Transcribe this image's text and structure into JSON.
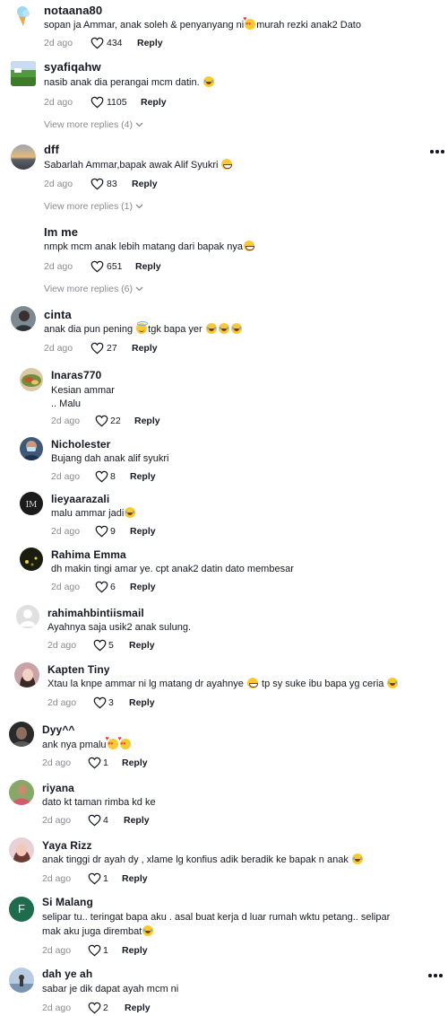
{
  "comments": [
    {
      "username": "notaana80",
      "text_parts": [
        "sopan ja Ammar, anak soleh & penyanyang ni",
        "murah rezki anak2 Dato"
      ],
      "emojis": [
        "smiling-face-with-hearts"
      ],
      "time": "2d ago",
      "likes": "434",
      "reply": "Reply",
      "avatar": "ice-cream-avatar"
    },
    {
      "username": "syafiqahw",
      "text_parts": [
        "nasib anak dia perangai mcm datin. "
      ],
      "emojis": [
        "face-with-tears-of-joy"
      ],
      "time": "2d ago",
      "likes": "1105",
      "reply": "Reply",
      "view_more": "View more replies (4)",
      "avatar": "green-landscape-avatar"
    },
    {
      "username": "dff",
      "text_parts": [
        "Sabarlah Ammar,bapak awak Alif Syukri "
      ],
      "emojis": [
        "grinning-sweat-face"
      ],
      "time": "2d ago",
      "likes": "83",
      "reply": "Reply",
      "view_more": "View more replies (1)",
      "avatar": "sunset-avatar"
    },
    {
      "username": "Im me",
      "text_parts": [
        "nmpk mcm anak lebih matang dari bapak nya"
      ],
      "emojis": [
        "grinning-sweat-face"
      ],
      "time": "2d ago",
      "likes": "651",
      "reply": "Reply",
      "view_more": "View more replies (6)"
    },
    {
      "username": "cinta",
      "text_parts": [
        "anak dia pun pening ",
        "tgk bapa yer "
      ],
      "emojis": [
        "smiling-face-with-halo",
        "face-with-tears-of-joy x3"
      ],
      "time": "2d ago",
      "likes": "27",
      "reply": "Reply",
      "avatar": "person-avatar"
    },
    {
      "username": "Inaras770",
      "text_lines": [
        "Kesian ammar",
        ".. Malu"
      ],
      "time": "2d ago",
      "likes": "22",
      "reply": "Reply",
      "avatar": "food-avatar"
    },
    {
      "username": "Nicholester",
      "text_parts": [
        "Bujang dah anak alif syukri"
      ],
      "time": "2d ago",
      "likes": "8",
      "reply": "Reply",
      "avatar": "masked-person-avatar"
    },
    {
      "username": "lieyaarazali",
      "text_parts": [
        "malu ammar jadi"
      ],
      "emojis": [
        "face-with-tears-of-joy"
      ],
      "time": "2d ago",
      "likes": "9",
      "reply": "Reply",
      "avatar": "dark-logo-avatar"
    },
    {
      "username": "Rahima Emma",
      "text_parts": [
        "dh makin tingi amar ye. cpt anak2 datin dato membesar"
      ],
      "time": "2d ago",
      "likes": "6",
      "reply": "Reply",
      "avatar": "night-avatar"
    },
    {
      "username": "rahimahbintiismail",
      "text_parts": [
        "Ayahnya saja usik2 anak sulung."
      ],
      "time": "2d ago",
      "likes": "5",
      "reply": "Reply",
      "avatar": "default-avatar"
    },
    {
      "username": "Kapten Tiny",
      "text_parts": [
        "Xtau la knpe ammar ni lg matang dr ayahnye ",
        " tp sy suke ibu bapa yg ceria "
      ],
      "emojis": [
        "grimacing-face",
        "face-with-tears-of-joy"
      ],
      "time": "2d ago",
      "likes": "3",
      "reply": "Reply",
      "avatar": "woman-avatar"
    },
    {
      "username": "Dyy^^",
      "text_parts": [
        "ank nya pmalu"
      ],
      "emojis": [
        "smiling-face-with-hearts x2"
      ],
      "time": "2d ago",
      "likes": "1",
      "reply": "Reply",
      "avatar": "dark-person-avatar"
    },
    {
      "username": "riyana",
      "text_parts": [
        "dato kt taman rimba kd ke"
      ],
      "time": "2d ago",
      "likes": "4",
      "reply": "Reply",
      "avatar": "outdoor-person-avatar"
    },
    {
      "username": "Yaya Rizz",
      "text_parts": [
        "anak tinggi dr ayah dy , xlame lg konfius adik beradik ke bapak n anak "
      ],
      "emojis": [
        "face-with-tears-of-joy"
      ],
      "time": "2d ago",
      "likes": "1",
      "reply": "Reply",
      "avatar": "woman-pink-avatar"
    },
    {
      "username": "Si Malang",
      "text_lines": [
        "selipar tu.. teringat bapa aku . asal buat kerja d luar rumah wktu petang.. selipar",
        "mak aku juga dirembat"
      ],
      "emojis": [
        "face-with-tears-of-joy"
      ],
      "time": "2d ago",
      "likes": "1",
      "reply": "Reply",
      "avatar_letter": "F"
    },
    {
      "username": "dah ye ah",
      "text_parts": [
        "sabar je dik dapat ayah mcm ni"
      ],
      "time": "2d ago",
      "likes": "2",
      "reply": "Reply",
      "avatar": "silhouette-avatar"
    }
  ],
  "colors": {
    "text": "#161823",
    "secondary": "#8a8b91",
    "avatar_letter_bg": "#1f6b4e"
  }
}
